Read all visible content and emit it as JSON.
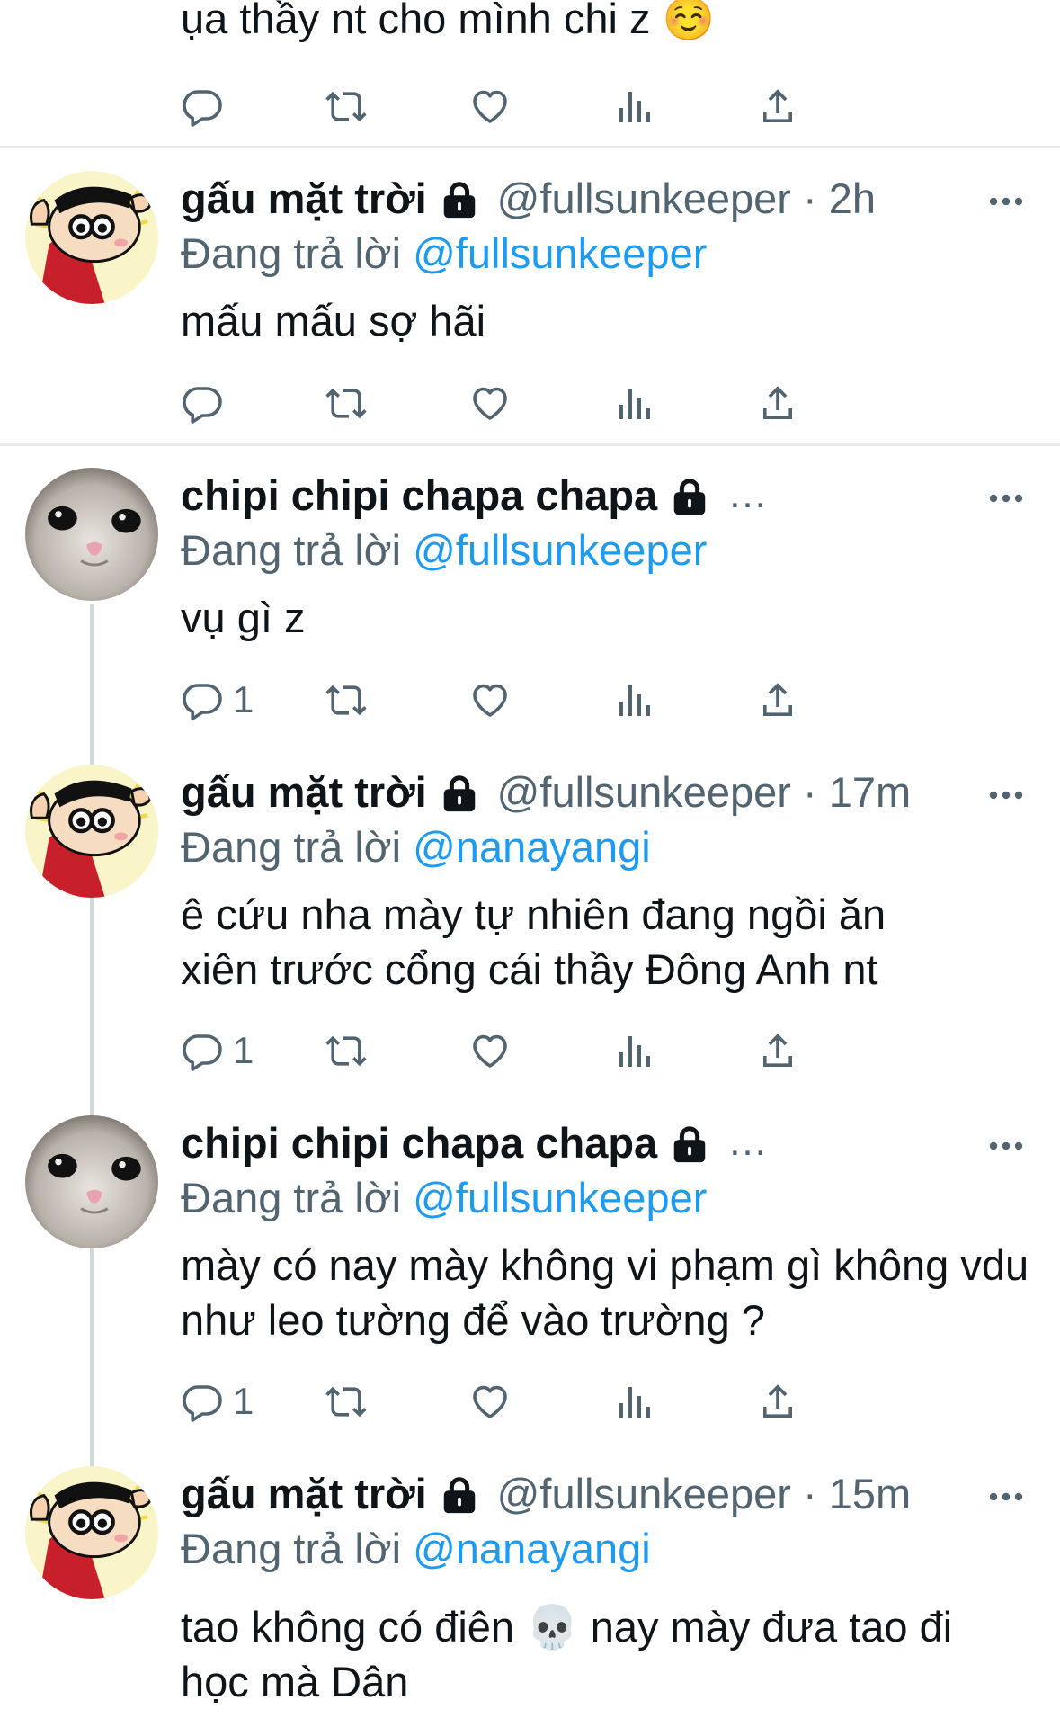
{
  "top": {
    "text": "ụa thầy nt cho mình chi z ☺️"
  },
  "tweets": [
    {
      "name": "gấu mặt trời",
      "handle": "@fullsunkeeper · 2h",
      "reply_prefix": "Đang trả lời ",
      "reply_to": "@fullsunkeeper",
      "text": "mấu mấu sợ hãi",
      "reply_count": ""
    },
    {
      "name": "chipi chipi chapa chapa",
      "handle": "...",
      "reply_prefix": "Đang trả lời ",
      "reply_to": "@fullsunkeeper",
      "text": "vụ gì z",
      "reply_count": "1"
    },
    {
      "name": "gấu mặt trời",
      "handle": "@fullsunkeeper · 17m",
      "reply_prefix": "Đang trả lời ",
      "reply_to": "@nanayangi",
      "text": "ê cứu nha mày tự nhiên đang ngồi ăn xiên trước cổng cái thầy Đông Anh nt",
      "reply_count": "1"
    },
    {
      "name": "chipi chipi chapa chapa",
      "handle": "...",
      "reply_prefix": "Đang trả lời ",
      "reply_to": "@fullsunkeeper",
      "text": "mày có nay mày không vi phạm gì không vdu như leo tường để vào trường ?",
      "reply_count": "1"
    },
    {
      "name": "gấu mặt trời",
      "handle": "@fullsunkeeper · 15m",
      "reply_prefix": "Đang trả lời ",
      "reply_to": "@nanayangi",
      "text": "tao không có điên 💀 nay mày đưa tao đi học mà Dân",
      "reply_count": ""
    }
  ],
  "icons": {
    "reply": "speech-bubble-icon",
    "retweet": "retweet-icon",
    "like": "heart-icon",
    "views": "bar-chart-icon",
    "share": "share-icon",
    "more": "more-dots-icon",
    "lock": "lock-icon"
  },
  "colors": {
    "text": "#0f1419",
    "secondary": "#536471",
    "mention": "#1d9bf0",
    "divider": "#e7e9ea"
  }
}
